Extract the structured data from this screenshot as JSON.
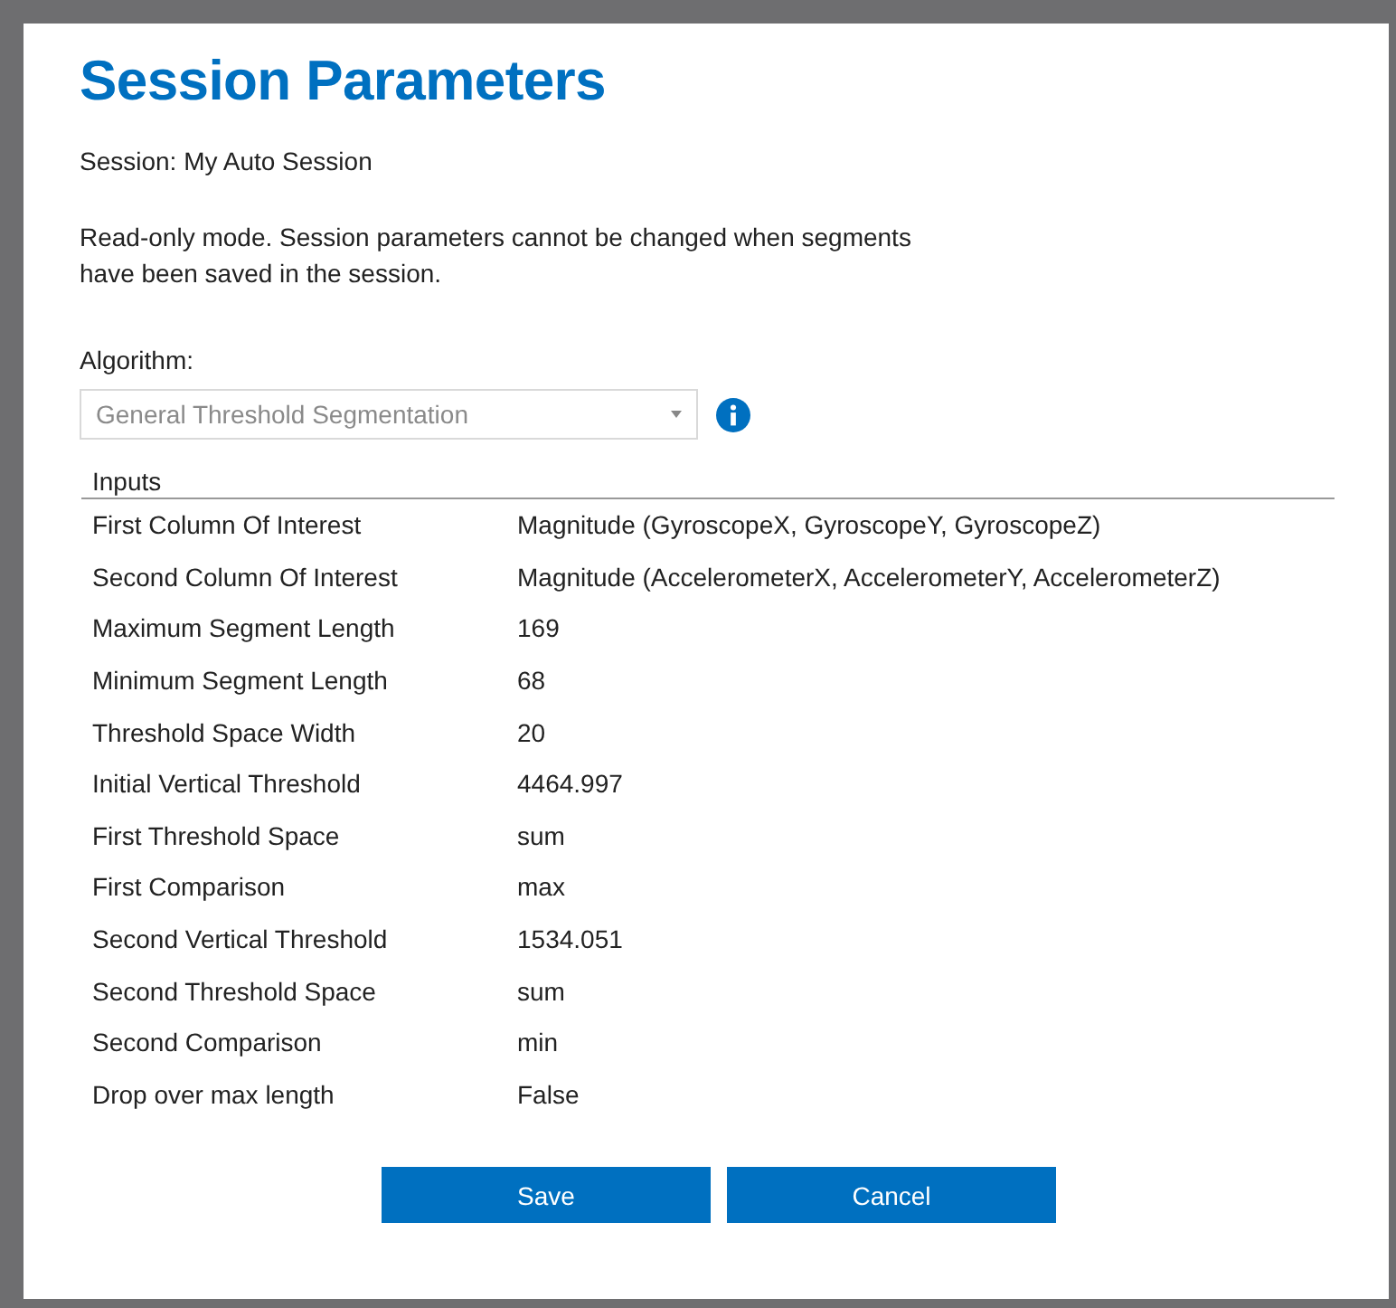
{
  "dialog": {
    "title": "Session Parameters",
    "session": "Session: My Auto Session",
    "notice": "Read-only mode. Session parameters cannot be changed when segments have been saved in the session.",
    "algorithm": {
      "label": "Algorithm:",
      "value": "General Threshold Segmentation",
      "disabled": true
    },
    "inputs": {
      "heading": "Inputs",
      "rows": [
        {
          "name": "First Column Of Interest",
          "value": "Magnitude (GyroscopeX, GyroscopeY, GyroscopeZ)"
        },
        {
          "name": "Second Column Of Interest",
          "value": "Magnitude (AccelerometerX, AccelerometerY, AccelerometerZ)"
        },
        {
          "name": "Maximum Segment Length",
          "value": "169"
        },
        {
          "name": "Minimum Segment Length",
          "value": "68"
        },
        {
          "name": "Threshold Space Width",
          "value": "20"
        },
        {
          "name": "Initial Vertical Threshold",
          "value": "4464.997"
        },
        {
          "name": "First Threshold Space",
          "value": "sum"
        },
        {
          "name": "First Comparison",
          "value": "max"
        },
        {
          "name": "Second Vertical Threshold",
          "value": "1534.051"
        },
        {
          "name": "Second Threshold Space",
          "value": "sum"
        },
        {
          "name": "Second Comparison",
          "value": "min"
        },
        {
          "name": "Drop over max length",
          "value": "False"
        }
      ]
    },
    "buttons": [
      "Save",
      "Cancel"
    ]
  }
}
